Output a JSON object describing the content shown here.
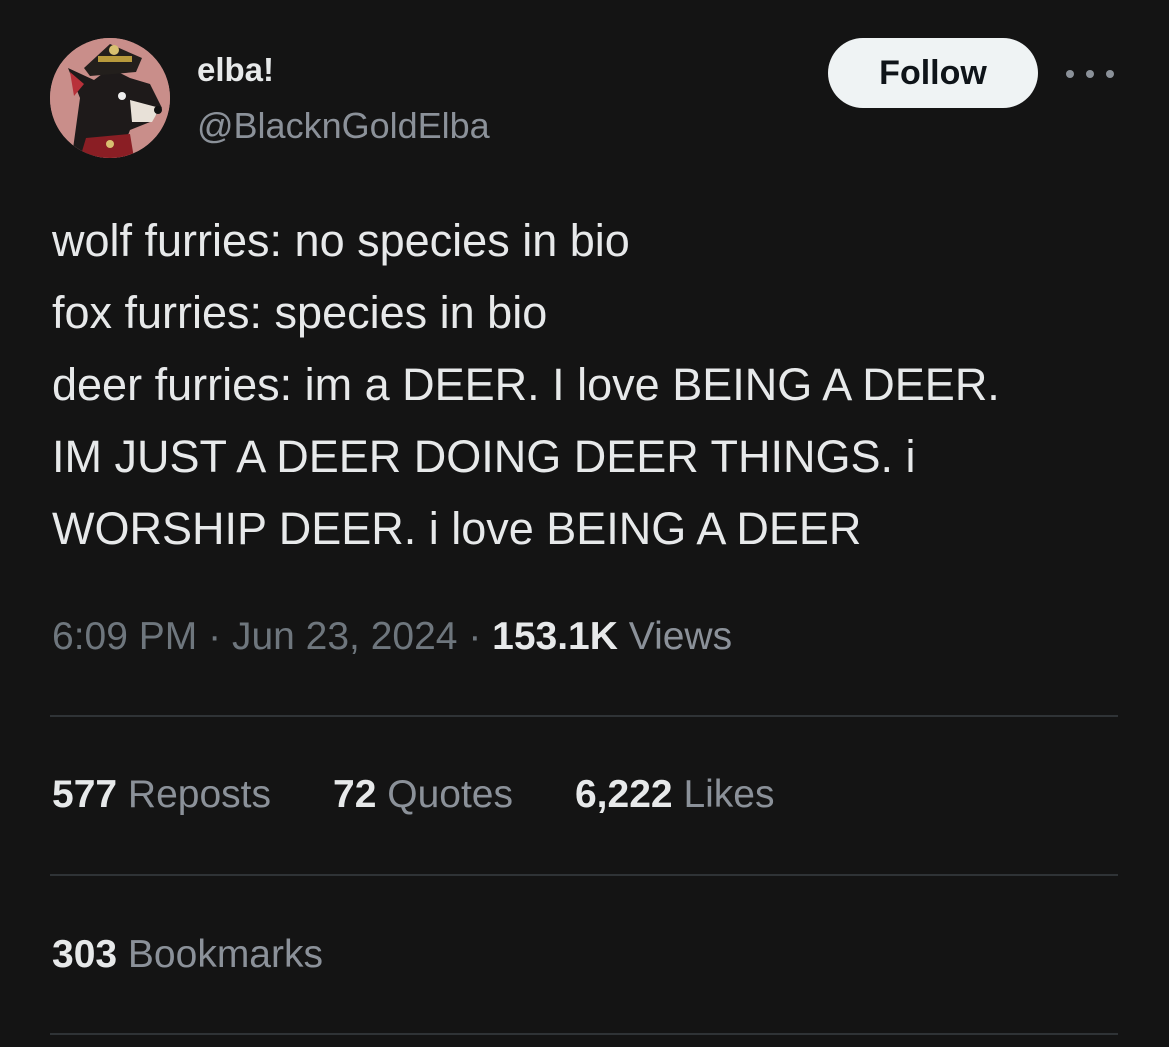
{
  "author": {
    "display_name": "elba!",
    "handle": "@BlacknGoldElba",
    "avatar_icon": "furry-wolf-avatar-icon"
  },
  "header": {
    "follow_label": "Follow",
    "more_icon": "more-horizontal-icon"
  },
  "tweet": {
    "lines": [
      "wolf furries: no species in bio",
      "fox furries: species in bio",
      "deer furries: im a DEER. I love BEING A DEER.",
      "IM JUST A DEER DOING DEER THINGS. i",
      "WORSHIP DEER. i love BEING A DEER"
    ]
  },
  "meta": {
    "time": "6:09 PM",
    "separator": "·",
    "date": "Jun 23, 2024",
    "views_count": "153.1K",
    "views_label": "Views"
  },
  "stats": {
    "reposts_count": "577",
    "reposts_label": "Reposts",
    "quotes_count": "72",
    "quotes_label": "Quotes",
    "likes_count": "6,222",
    "likes_label": "Likes",
    "bookmarks_count": "303",
    "bookmarks_label": "Bookmarks"
  },
  "colors": {
    "background": "#141414",
    "text_primary": "#e7e9ea",
    "text_secondary": "#8b9199",
    "divider": "#2f3336",
    "follow_bg": "#eff3f4"
  }
}
